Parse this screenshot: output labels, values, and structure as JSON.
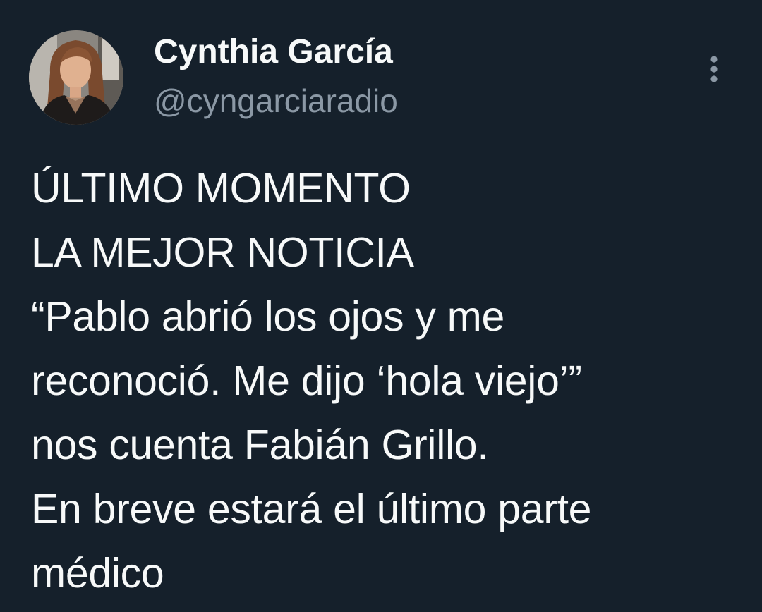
{
  "tweet": {
    "author": {
      "display_name": "Cynthia García",
      "handle": "@cyngarciaradio"
    },
    "more_icon": "more-vertical-icon",
    "text_lines": [
      "ÚLTIMO MOMENTO",
      "LA MEJOR NOTICIA",
      "“Pablo abrió los ojos y me",
      "reconoció. Me dijo ‘hola viejo’”",
      "nos cuenta Fabián Grillo.",
      "En breve estará el último parte",
      "médico"
    ]
  },
  "colors": {
    "background": "#15202b",
    "text_primary": "#f7f9f9",
    "text_secondary": "#8b98a5"
  }
}
